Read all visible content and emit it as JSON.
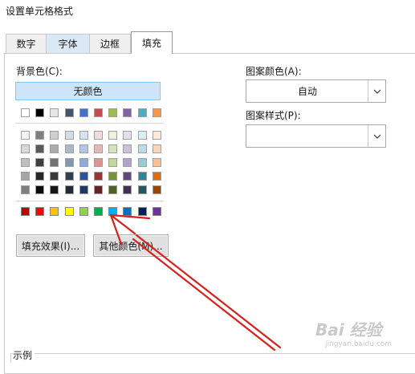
{
  "dialog": {
    "title": "设置单元格格式"
  },
  "tabs": [
    {
      "label": "数字"
    },
    {
      "label": "字体"
    },
    {
      "label": "边框"
    },
    {
      "label": "填充"
    }
  ],
  "fill": {
    "background_label": "背景色(C):",
    "no_color_label": "无颜色",
    "pattern_color_label": "图案颜色(A):",
    "pattern_color_value": "自动",
    "pattern_style_label": "图案样式(P):",
    "pattern_style_value": "",
    "fill_effects_button": "填充效果(I)...",
    "more_colors_button": "其他颜色(M)...",
    "sample_label": "示例"
  },
  "palette": {
    "theme_top": [
      "#ffffff",
      "#000000",
      "#e7e6e6",
      "#44546a",
      "#4472c4",
      "#c0504d",
      "#9bbb59",
      "#8064a2",
      "#4bacc6",
      "#f79646"
    ],
    "theme_shades": [
      [
        "#f2f2f2",
        "#7f7f7f",
        "#d0cece",
        "#d6dce4",
        "#d9e2f3",
        "#f2dcdb",
        "#ebf1dd",
        "#e5e0ec",
        "#dbeef3",
        "#fdeada"
      ],
      [
        "#d8d8d8",
        "#595959",
        "#aeaaaa",
        "#adb9ca",
        "#b4c6e7",
        "#e5b9b7",
        "#d7e3bc",
        "#ccc1d9",
        "#b7dde8",
        "#fbd5b5"
      ],
      [
        "#bfbfbf",
        "#3f3f3f",
        "#757171",
        "#8496b0",
        "#8eaadb",
        "#d99694",
        "#c3d69b",
        "#b2a2c7",
        "#92cddc",
        "#fac08f"
      ],
      [
        "#a5a5a5",
        "#262626",
        "#3a3838",
        "#323f4f",
        "#2f5496",
        "#953734",
        "#76923c",
        "#5f497a",
        "#31859b",
        "#e36c09"
      ],
      [
        "#7f7f7f",
        "#0c0c0c",
        "#171616",
        "#222a35",
        "#1f3864",
        "#632423",
        "#4f6128",
        "#3f3151",
        "#205867",
        "#974806"
      ]
    ],
    "standard": [
      "#c00000",
      "#ff0000",
      "#ffc000",
      "#ffff00",
      "#92d050",
      "#00b050",
      "#00b0f0",
      "#0070c0",
      "#002060",
      "#7030a0"
    ]
  },
  "watermark": {
    "text": "Bai 经验",
    "sub": "jingyan.baidu.com"
  },
  "annotation_color": "#d9201c"
}
